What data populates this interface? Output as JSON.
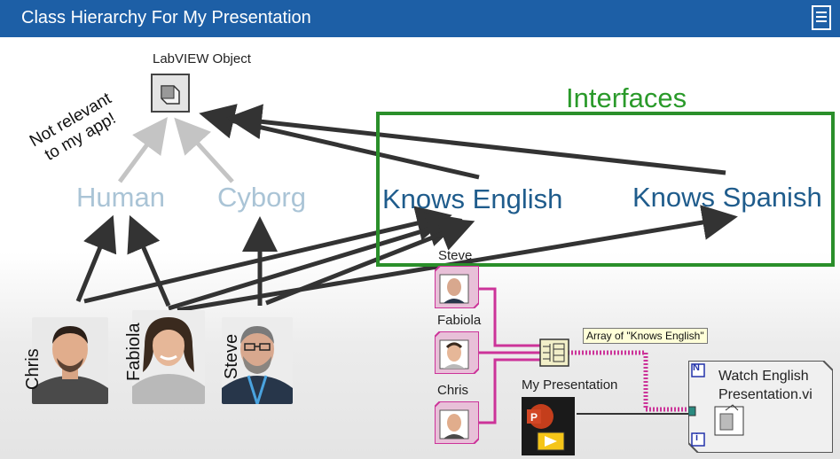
{
  "header": {
    "title": "Class Hierarchy For My Presentation"
  },
  "diagram": {
    "root_label": "LabVIEW Object",
    "note_line1": "Not relevant",
    "note_line2": "to my app!",
    "human_label": "Human",
    "cyborg_label": "Cyborg",
    "interfaces_title": "Interfaces",
    "knows_english": "Knows English",
    "knows_spanish": "Knows Spanish",
    "people": [
      "Chris",
      "Fabiola",
      "Steve"
    ]
  },
  "block_diagram": {
    "steve_label": "Steve",
    "fabiola_label": "Fabiola",
    "chris_label": "Chris",
    "tooltip": "Array of \"Knows English\"",
    "presentation_label": "My Presentation",
    "vi_label_line1": "Watch English",
    "vi_label_line2": "Presentation.vi",
    "n_terminal": "N",
    "i_terminal": "i"
  },
  "colors": {
    "title_bar": "#1d5fa6",
    "interfaces_green": "#2a8f2a",
    "wire_pink": "#cc3399",
    "arrow_dark": "#333333",
    "arrow_faded": "#c4c4c4"
  }
}
